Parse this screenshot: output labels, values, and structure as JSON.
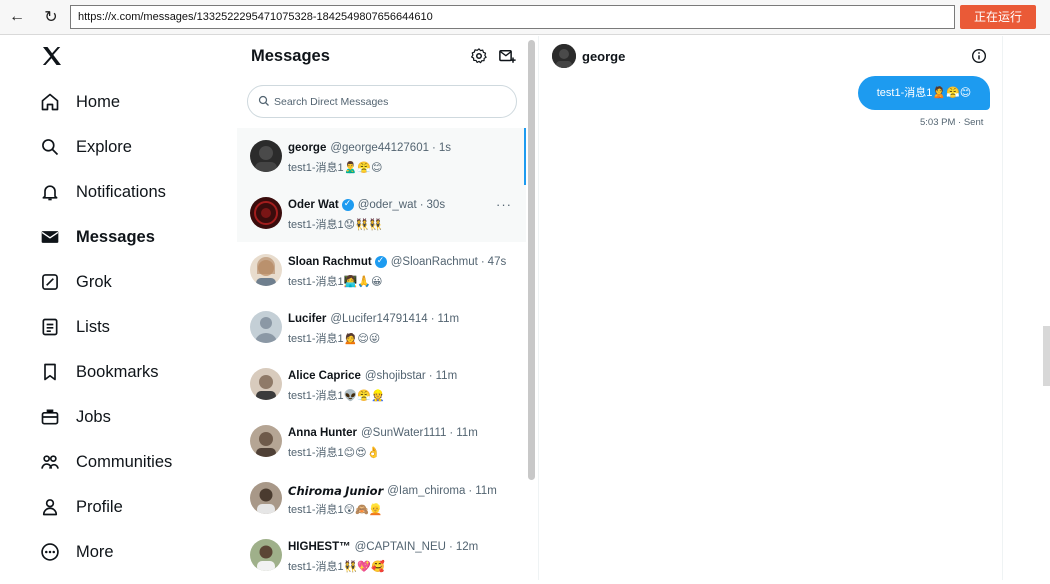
{
  "browser": {
    "back_icon": "←",
    "reload_icon": "↻",
    "url": "https://x.com/messages/1332522295471075328-1842549807656644610",
    "run_button": "正在运行"
  },
  "nav": {
    "items": [
      {
        "label": "Home",
        "icon": "home-icon"
      },
      {
        "label": "Explore",
        "icon": "search-icon"
      },
      {
        "label": "Notifications",
        "icon": "bell-icon"
      },
      {
        "label": "Messages",
        "icon": "envelope-icon"
      },
      {
        "label": "Grok",
        "icon": "grok-icon"
      },
      {
        "label": "Lists",
        "icon": "list-icon"
      },
      {
        "label": "Bookmarks",
        "icon": "bookmark-icon"
      },
      {
        "label": "Jobs",
        "icon": "briefcase-icon"
      },
      {
        "label": "Communities",
        "icon": "people-icon"
      },
      {
        "label": "Profile",
        "icon": "person-icon"
      },
      {
        "label": "More",
        "icon": "more-circle-icon"
      }
    ]
  },
  "messages": {
    "title": "Messages",
    "search_placeholder": "Search Direct Messages",
    "conversations": [
      {
        "name": "george",
        "handle": "@george44127601",
        "time": "1s",
        "preview": "test1-消息1🙎‍♂️😤😊",
        "verified": false,
        "avatar_color": "#2b2b2b"
      },
      {
        "name": "Oder Wat",
        "handle": "@oder_wat",
        "time": "30s",
        "preview": "test1-消息1😟👯👯",
        "verified": true,
        "avatar_color": "#3a0c0c"
      },
      {
        "name": "Sloan Rachmut",
        "handle": "@SloanRachmut",
        "time": "47s",
        "preview": "test1-消息1👩‍💻🙏😀",
        "verified": true,
        "avatar_color": "#c9b8a4"
      },
      {
        "name": "Lucifer",
        "handle": "@Lucifer14791414",
        "time": "11m",
        "preview": "test1-消息1🙍😌😜",
        "verified": false,
        "avatar_color": "#c4cfd6"
      },
      {
        "name": "Alice Caprice",
        "handle": "@shojibstar",
        "time": "11m",
        "preview": "test1-消息1👽😤👷",
        "verified": false,
        "avatar_color": "#8f7a68"
      },
      {
        "name": "Anna Hunter",
        "handle": "@SunWater1111",
        "time": "11m",
        "preview": "test1-消息1😊😍👌",
        "verified": false,
        "avatar_color": "#6e5a4a"
      },
      {
        "name": "𝘾𝙝𝙞𝙧𝙤𝙢𝙖 𝙅𝙪𝙣𝙞𝙤𝙧",
        "handle": "@Iam_chiroma",
        "time": "11m",
        "preview": "test1-消息1😲🙈👱",
        "verified": false,
        "avatar_color": "#4a3b2f"
      },
      {
        "name": "HIGHEST™",
        "handle": "@CAPTAIN_NEU",
        "time": "12m",
        "preview": "test1-消息1👯💖🥰",
        "verified": false,
        "avatar_color": "#5b6b4a"
      }
    ]
  },
  "chat": {
    "name": "george",
    "bubble_text": "test1-消息1🙎😤😊",
    "timestamp": "5:03 PM · Sent"
  },
  "colors": {
    "accent": "#1d9bf0",
    "run": "#ea5a37"
  }
}
